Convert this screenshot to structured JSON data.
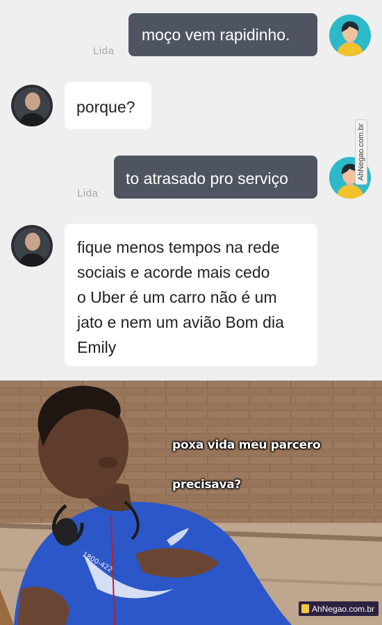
{
  "chat": {
    "messages": [
      {
        "side": "out",
        "text": "moço vem rapidinho.",
        "status": "Lida"
      },
      {
        "side": "in",
        "text": "porque?"
      },
      {
        "side": "out",
        "text": "to atrasado pro serviço",
        "status": "Lida"
      },
      {
        "side": "in",
        "lines": [
          "fique menos tempos na rede",
          "sociais e acorde mais cedo",
          "o Uber é um carro não é um",
          "jato e nem um avião Bom dia",
          "Emily"
        ]
      }
    ],
    "avatars": {
      "sender": "user-cartoon-avatar",
      "receiver": "blurred-photo-avatar"
    },
    "colors": {
      "background": "#efefef",
      "outgoing_bubble": "#4f5461",
      "incoming_bubble": "#ffffff"
    }
  },
  "meme": {
    "captions": [
      "poxa vida meu parcero",
      "precisava?"
    ],
    "shirt_print": "1800-422"
  },
  "watermarks": {
    "side": "AhNegao.com.br",
    "bottom": "AhNegao.com.br"
  }
}
